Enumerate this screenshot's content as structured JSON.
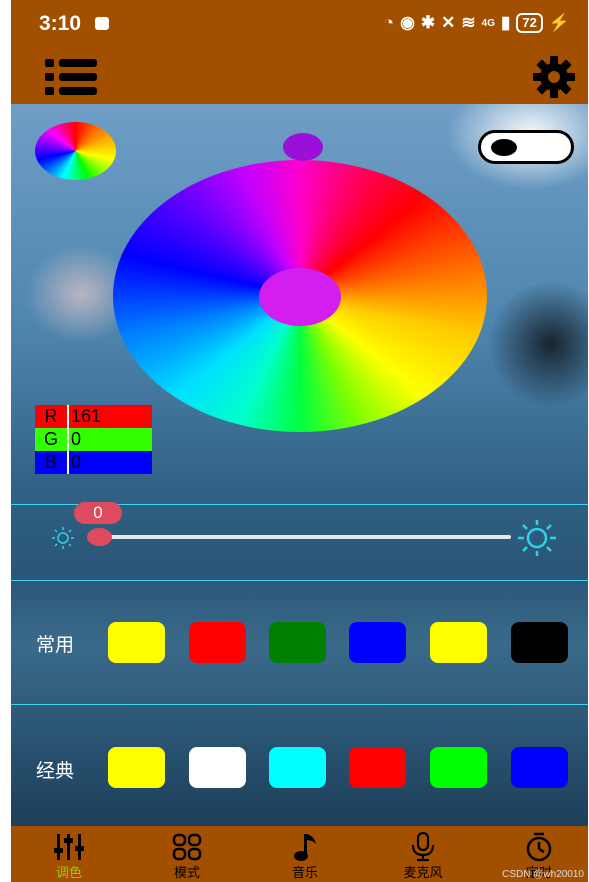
{
  "status_bar": {
    "time": "3:10",
    "signal_text": "4G",
    "battery": "72"
  },
  "header": {
    "menu_icon": "list-icon",
    "settings_icon": "gear-icon"
  },
  "rgb": {
    "r_label": "R",
    "r_value": "161",
    "g_label": "G",
    "g_value": "0",
    "b_label": "B",
    "b_value": "0",
    "colors": {
      "r": "#ff0000",
      "g": "#33ff00",
      "b": "#0000ff"
    }
  },
  "brightness": {
    "value": "0",
    "level": 0
  },
  "rows": {
    "common_label": "常用",
    "common_colors": [
      "#ffff00",
      "#ff0000",
      "#008000",
      "#0000ff",
      "#ffff00",
      "#000000"
    ],
    "classic_label": "经典",
    "classic_colors": [
      "#ffff00",
      "#ffffff",
      "#00ffff",
      "#ff0000",
      "#00ff00",
      "#0000ff"
    ]
  },
  "nav": {
    "items": [
      {
        "label": "调色",
        "icon": "sliders-icon",
        "active": true
      },
      {
        "label": "模式",
        "icon": "grid-icon",
        "active": false
      },
      {
        "label": "音乐",
        "icon": "music-note-icon",
        "active": false
      },
      {
        "label": "麦克风",
        "icon": "microphone-icon",
        "active": false
      },
      {
        "label": "定时",
        "icon": "timer-icon",
        "active": false
      }
    ]
  },
  "watermark": "CSDN @wh20010"
}
